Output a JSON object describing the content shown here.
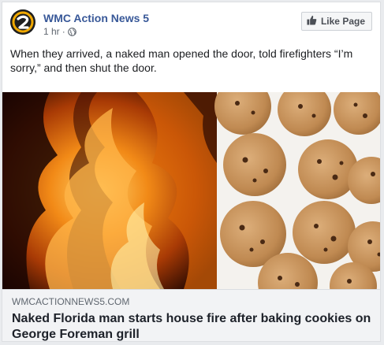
{
  "post": {
    "page_name": "WMC Action News 5",
    "time": "1 hr",
    "separator": "·",
    "audience_icon": "globe-icon",
    "like_page_label": "Like Page",
    "like_icon": "thumbs-up-icon",
    "text": "When they arrived, a naked man opened the door, told firefighters “I’m sorry,” and then shut the door."
  },
  "link": {
    "domain": "WMCACTIONNEWS5.COM",
    "headline": "Naked Florida man starts house fire after baking cookies on George Foreman grill"
  },
  "colors": {
    "page_name": "#385898",
    "background": "#e9ebee",
    "link_bar": "#f2f3f5"
  }
}
